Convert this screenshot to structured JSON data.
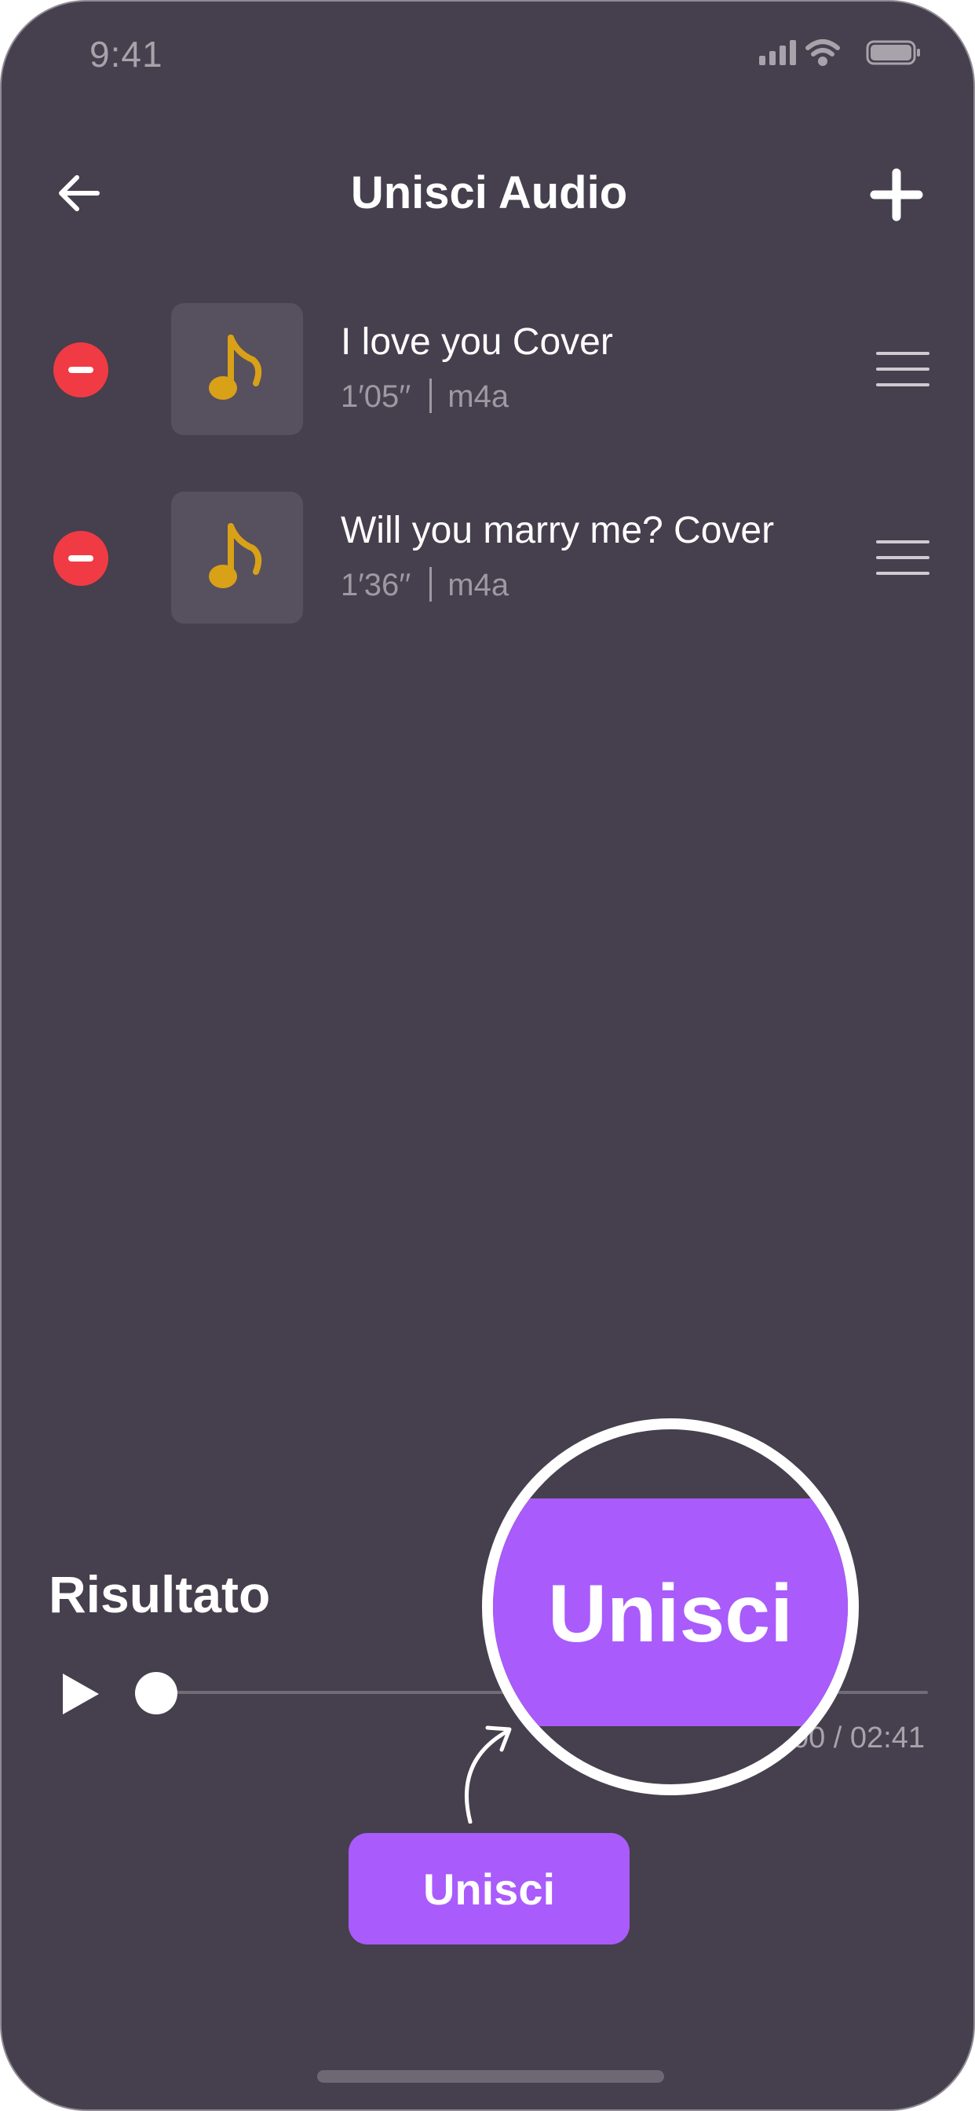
{
  "status_bar": {
    "time": "9:41"
  },
  "header": {
    "title": "Unisci Audio"
  },
  "tracks": [
    {
      "title": "I love you Cover",
      "duration": "1′05′′",
      "format": "m4a"
    },
    {
      "title": "Will you marry me? Cover",
      "duration": "1′36′′",
      "format": "m4a"
    }
  ],
  "result": {
    "label": "Risultato",
    "time_readout": "00:00 / 02:41",
    "progress": 0
  },
  "merge_button": {
    "label": "Unisci"
  },
  "magnifier": {
    "label": "Unisci"
  },
  "colors": {
    "background": "#463f4d",
    "accent": "#a95bfb",
    "remove": "#f03b44",
    "note": "#d8a117"
  },
  "icons": [
    "back-arrow-icon",
    "plus-icon",
    "remove-icon",
    "music-note-icon",
    "drag-handle-icon",
    "play-icon",
    "signal-icon",
    "wifi-icon",
    "battery-icon"
  ]
}
